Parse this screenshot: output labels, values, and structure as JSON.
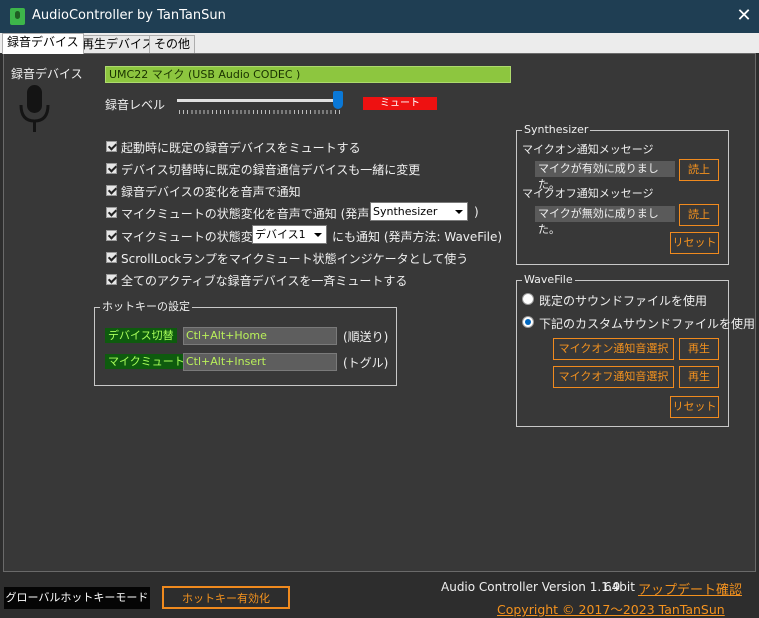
{
  "window": {
    "title": "AudioController by TanTanSun",
    "close_glyph": "✕"
  },
  "tabs": [
    {
      "label": "録音デバイス",
      "active": true
    },
    {
      "label": "再生デバイス",
      "active": false
    },
    {
      "label": "その他",
      "active": false
    }
  ],
  "recording": {
    "device_label": "録音デバイス",
    "device_value": "UMC22 マイク (USB Audio CODEC )",
    "level_label": "録音レベル",
    "level_percent": 97,
    "mute_label": "ミュート"
  },
  "options": [
    {
      "text": "起動時に既定の録音デバイスをミュートする",
      "checked": true
    },
    {
      "text": "デバイス切替時に既定の録音通信デバイスも一緒に変更",
      "checked": true
    },
    {
      "text": "録音デバイスの変化を音声で通知",
      "checked": true
    },
    {
      "text": "マイクミュートの状態変化を音声で通知 (発声方法:",
      "checked": true
    },
    {
      "text": "マイクミュートの状態変化を",
      "checked": true
    },
    {
      "text": "ScrollLockランプをマイクミュート状態インジケータとして使う",
      "checked": true
    },
    {
      "text": "全てのアクティブな録音デバイスを一斉ミュートする",
      "checked": true
    }
  ],
  "voice_method": {
    "selected": "Synthesizer",
    "suffix": ")"
  },
  "notify_device": {
    "selected": "デバイス1",
    "suffix": "にも通知 (発声方法: WaveFile)"
  },
  "hotkeys": {
    "title": "ホットキーの設定",
    "rows": [
      {
        "label": "デバイス切替",
        "value": "Ctl+Alt+Home",
        "note": "(順送り)"
      },
      {
        "label": "マイクミュート",
        "value": "Ctl+Alt+Insert",
        "note": "(トグル)"
      }
    ]
  },
  "synth": {
    "title": "Synthesizer",
    "on_label": "マイクオン通知メッセージ",
    "on_value": "マイクが有効に成りました。",
    "off_label": "マイクオフ通知メッセージ",
    "off_value": "マイクが無効に成りました。",
    "read_label": "読上",
    "reset_label": "リセット"
  },
  "wavefile": {
    "title": "WaveFile",
    "option_default": "既定のサウンドファイルを使用",
    "option_custom": "下記のカスタムサウンドファイルを使用",
    "selected": "custom",
    "on_select": "マイクオン通知音選択",
    "off_select": "マイクオフ通知音選択",
    "play_label": "再生",
    "reset_label": "リセット"
  },
  "footer": {
    "hotkey_mode": "グローバルホットキーモード",
    "hotkey_enable": "ホットキー有効化",
    "version": "Audio Controller Version 1.1.9",
    "arch": "64bit",
    "update_link": "アップデート確認",
    "copyright": "Copyright © 2017～2023 TanTanSun"
  },
  "colors": {
    "device_field": "#8dc63f",
    "mute": "#ee1111",
    "accent_orange": "#f4921e",
    "titlebar": "#1f3e53"
  },
  "icons": {
    "window": "microphone-app-icon",
    "device": "microphone-icon"
  }
}
